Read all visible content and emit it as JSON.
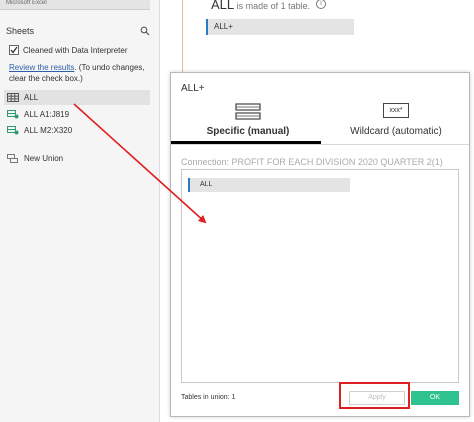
{
  "connection": {
    "subtitle": "Microsoft Excel"
  },
  "sidebar": {
    "title": "Sheets",
    "data_interpreter": {
      "checkbox_label": "Cleaned with Data Interpreter",
      "review_link": "Review the results",
      "review_rest": ". (To undo changes, clear the check box.)"
    },
    "items": [
      {
        "label": "ALL",
        "icon": "table-icon",
        "selected": true
      },
      {
        "label": "ALL A1:J819",
        "icon": "named-range-icon",
        "selected": false
      },
      {
        "label": "ALL M2:X320",
        "icon": "named-range-icon",
        "selected": false
      },
      {
        "label": "New Union",
        "icon": "union-icon",
        "selected": false
      }
    ]
  },
  "main": {
    "title_big": "ALL",
    "title_small": " is made of 1 table.",
    "chip_label": "ALL+"
  },
  "dialog": {
    "title": "ALL+",
    "tabs": [
      {
        "label": "Specific (manual)",
        "active": true,
        "icon": "specific-tables-icon"
      },
      {
        "label": "Wildcard (automatic)",
        "active": false,
        "icon": "wildcard-icon",
        "icon_text": "xxx*"
      }
    ],
    "connection_label": "Connection: PROFIT FOR EACH DIVISION 2020 QUARTER 2(1)",
    "tables": [
      "ALL"
    ],
    "tables_count": "Tables in union: 1",
    "apply_label": "Apply",
    "ok_label": "OK"
  },
  "colors": {
    "annotation": "#e02020",
    "ok_button": "#2fc28f",
    "accent": "#2b7bc1",
    "link": "#2a5fa8"
  }
}
